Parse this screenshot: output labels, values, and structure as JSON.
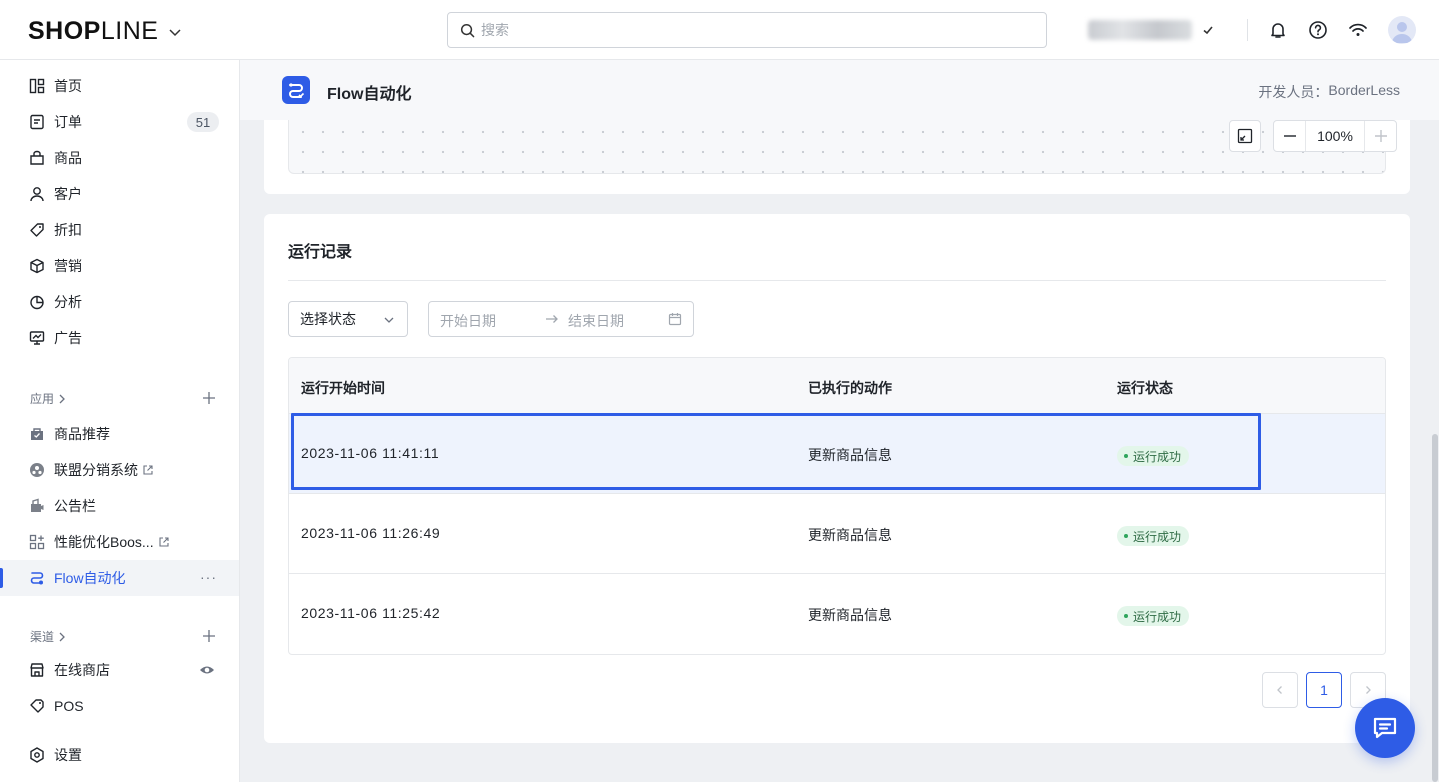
{
  "topbar": {
    "logo_bold": "SHOP",
    "logo_light": "LINE",
    "search_placeholder": "搜索"
  },
  "sidebar": {
    "main_items": [
      {
        "label": "首页",
        "icon": "home-icon"
      },
      {
        "label": "订单",
        "icon": "order-icon",
        "badge": "51"
      },
      {
        "label": "商品",
        "icon": "product-icon"
      },
      {
        "label": "客户",
        "icon": "customer-icon"
      },
      {
        "label": "折扣",
        "icon": "discount-icon"
      },
      {
        "label": "营销",
        "icon": "marketing-icon"
      },
      {
        "label": "分析",
        "icon": "analytics-icon"
      },
      {
        "label": "广告",
        "icon": "ads-icon"
      }
    ],
    "apps_label": "应用",
    "apps": [
      {
        "label": "商品推荐",
        "icon": "product-recommend-icon"
      },
      {
        "label": "联盟分销系统",
        "icon": "affiliate-icon"
      },
      {
        "label": "公告栏",
        "icon": "announcement-icon"
      },
      {
        "label": "性能优化Boos...",
        "icon": "performance-icon"
      },
      {
        "label": "Flow自动化",
        "icon": "flow-icon"
      }
    ],
    "channels_label": "渠道",
    "channels": [
      {
        "label": "在线商店",
        "icon": "online-store-icon"
      },
      {
        "label": "POS",
        "icon": "pos-icon"
      }
    ],
    "settings_label": "设置"
  },
  "page_header": {
    "title": "Flow自动化",
    "developer_label": "开发人员：",
    "developer": "BorderLess"
  },
  "canvas": {
    "zoom": "100%"
  },
  "records": {
    "title": "运行记录",
    "status_select": "选择状态",
    "start_date_placeholder": "开始日期",
    "end_date_placeholder": "结束日期",
    "columns": [
      "运行开始时间",
      "已执行的动作",
      "运行状态"
    ],
    "rows": [
      {
        "time": "2023-11-06 11:41:11",
        "action": "更新商品信息",
        "status": "运行成功"
      },
      {
        "time": "2023-11-06 11:26:49",
        "action": "更新商品信息",
        "status": "运行成功"
      },
      {
        "time": "2023-11-06 11:25:42",
        "action": "更新商品信息",
        "status": "运行成功"
      }
    ],
    "page": "1"
  },
  "colors": {
    "accent": "#2e5ce6",
    "success_bg": "#e3f6ea",
    "success_dot": "#2fa55c"
  }
}
